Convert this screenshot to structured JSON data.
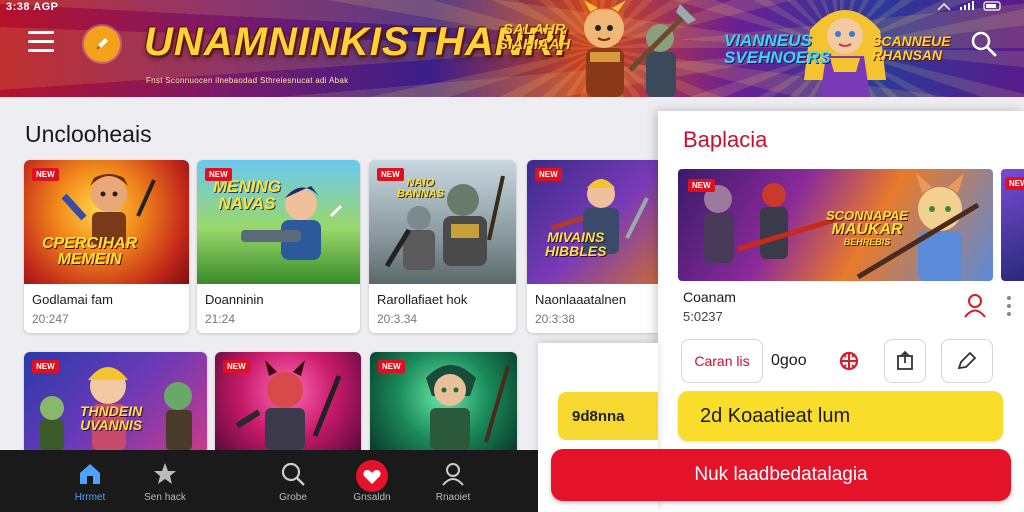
{
  "status_bar": {
    "time": "3:38 AGP"
  },
  "header": {
    "banner_title": "UNAMNINKISTHANR!",
    "banner_subtitle": "Fnst Sconnuocen ilnebaodad Sthreiesnucat adi Abak",
    "badge_left_line1": "SALAHR",
    "badge_left_line2": "SIAHIAAH",
    "badge_mid_line1": "VIANNEUS",
    "badge_mid_line2": "SVEHNOERS",
    "badge_right_line1": "SCANNEUE",
    "badge_right_line2": "RHANSAN"
  },
  "section": {
    "title": "Unclooheais"
  },
  "cards": [
    {
      "title": "Godlamai fam",
      "meta": "20:247",
      "tag": "NEW",
      "art_line1": "CPERCIHAR",
      "art_line2": "MEMEIN"
    },
    {
      "title": "Doanninin",
      "meta": "21:24",
      "tag": "NEW",
      "art_line1": "MENING",
      "art_line2": "NAVAS"
    },
    {
      "title": "Rarollafiaet hok",
      "meta": "20:3.34",
      "tag": "NEW",
      "art_line1": "NAIO",
      "art_line2": "BANNAS"
    },
    {
      "title": "Naonlaaatalnen",
      "meta": "20:3:38",
      "tag": "NEW",
      "art_line1": "MIVAINS",
      "art_line2": "HIBBLES"
    },
    {
      "tag": "NEW",
      "art_line1": "THNDEIN",
      "art_line2": "UVANNIS"
    },
    {
      "tag": "NEW"
    },
    {
      "tag": "NEW"
    }
  ],
  "panel": {
    "title": "Baplacia",
    "art_line1": "SCONNAPAE",
    "art_line2": "MAUKAR",
    "art_line3": "BEHREBIS",
    "name": "Coanam",
    "date": "5:0237",
    "create_label": "Caran lis",
    "count": "0goo",
    "yellow_label": "2d Koaatieat lum"
  },
  "overlay": {
    "yellow_label": "9d8nna"
  },
  "red_button": {
    "label": "Nuk laadbedatalagia"
  },
  "nav": [
    {
      "label": "Hrrmet",
      "icon": "home-icon"
    },
    {
      "label": "Sen hack",
      "icon": "star-icon"
    },
    {
      "label": "Grobe",
      "icon": "search-icon"
    },
    {
      "label": "Gnsaldn",
      "icon": "heart-icon"
    },
    {
      "label": "Rnaoiet",
      "icon": "profile-icon"
    }
  ],
  "colors": {
    "accent_red": "#e4132a",
    "accent_yellow": "#f8de2a",
    "nav_active": "#4ea2ff",
    "panel_title": "#c8102e"
  }
}
